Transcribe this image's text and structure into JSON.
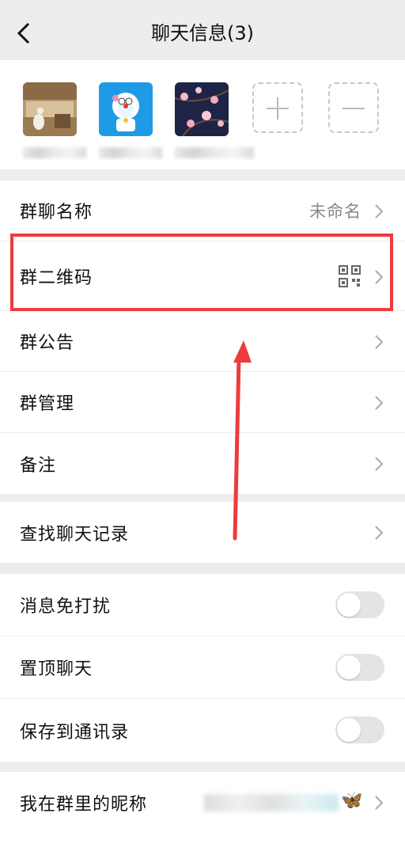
{
  "header": {
    "title": "聊天信息(3)"
  },
  "members": {
    "avatars": [
      {
        "icon": "photo-avatar-icon"
      },
      {
        "icon": "doraemon-avatar-icon"
      },
      {
        "icon": "flower-avatar-icon"
      }
    ],
    "add_icon": "plus-icon",
    "remove_icon": "minus-icon"
  },
  "section1": {
    "group_name_label": "群聊名称",
    "group_name_value": "未命名",
    "qr_label": "群二维码",
    "notice_label": "群公告",
    "manage_label": "群管理",
    "remark_label": "备注"
  },
  "section2": {
    "search_label": "查找聊天记录"
  },
  "section3": {
    "mute_label": "消息免打扰",
    "mute_on": false,
    "pin_label": "置顶聊天",
    "pin_on": false,
    "save_label": "保存到通讯录",
    "save_on": false
  },
  "section4": {
    "nickname_label": "我在群里的昵称",
    "nickname_emoji": "🦋"
  },
  "colors": {
    "annotation": "#ee3b3b",
    "background": "#ededed"
  }
}
